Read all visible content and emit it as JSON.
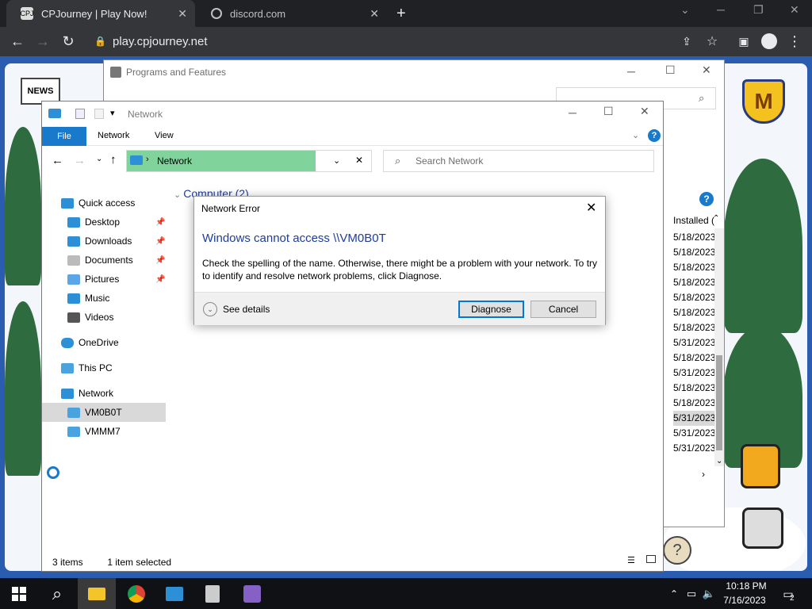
{
  "browser": {
    "tabs": [
      {
        "title": "CPJourney | Play Now!",
        "favicon": "CPJ",
        "active": true
      },
      {
        "title": "discord.com",
        "favicon": "globe-icon",
        "active": false
      }
    ],
    "url": "play.cpjourney.net"
  },
  "programs_window": {
    "title": "Programs and Features",
    "column_header": "Installed (",
    "install_dates": [
      "5/18/2023",
      "5/18/2023",
      "5/18/2023",
      "5/18/2023",
      "5/18/2023",
      "5/18/2023",
      "5/18/2023",
      "5/31/2023",
      "5/18/2023",
      "5/31/2023",
      "5/18/2023",
      "5/18/2023",
      "5/31/2023",
      "5/31/2023",
      "5/31/2023"
    ]
  },
  "explorer": {
    "title": "Network",
    "ribbon": {
      "file": "File",
      "tabs": [
        "Network",
        "View"
      ]
    },
    "address": "Network",
    "search_placeholder": "Search Network",
    "group_header": "Computer (2)",
    "nav": [
      {
        "label": "Quick access",
        "icon": "star-icon",
        "pinned": false
      },
      {
        "label": "Desktop",
        "icon": "desktop-icon",
        "pinned": true
      },
      {
        "label": "Downloads",
        "icon": "download-icon",
        "pinned": true
      },
      {
        "label": "Documents",
        "icon": "document-icon",
        "pinned": true
      },
      {
        "label": "Pictures",
        "icon": "picture-icon",
        "pinned": true
      },
      {
        "label": "Music",
        "icon": "music-icon",
        "pinned": false
      },
      {
        "label": "Videos",
        "icon": "video-icon",
        "pinned": false
      },
      {
        "label": "OneDrive",
        "icon": "cloud-icon",
        "pinned": false
      },
      {
        "label": "This PC",
        "icon": "pc-icon",
        "pinned": false
      },
      {
        "label": "Network",
        "icon": "network-icon",
        "pinned": false
      },
      {
        "label": "VM0B0T",
        "icon": "computer-icon",
        "pinned": false,
        "selected": true
      },
      {
        "label": "VMMM7",
        "icon": "computer-icon",
        "pinned": false
      }
    ],
    "status": {
      "items": "3 items",
      "selected": "1 item selected"
    }
  },
  "dialog": {
    "title": "Network Error",
    "heading": "Windows cannot access \\\\VM0B0T",
    "message": "Check the spelling of the name. Otherwise, there might be a problem with your network. To try to identify and resolve network problems, click Diagnose.",
    "details_label": "See details",
    "buttons": {
      "diagnose": "Diagnose",
      "cancel": "Cancel"
    }
  },
  "taskbar": {
    "time": "10:18 PM",
    "date": "7/16/2023",
    "notification_count": "2"
  }
}
